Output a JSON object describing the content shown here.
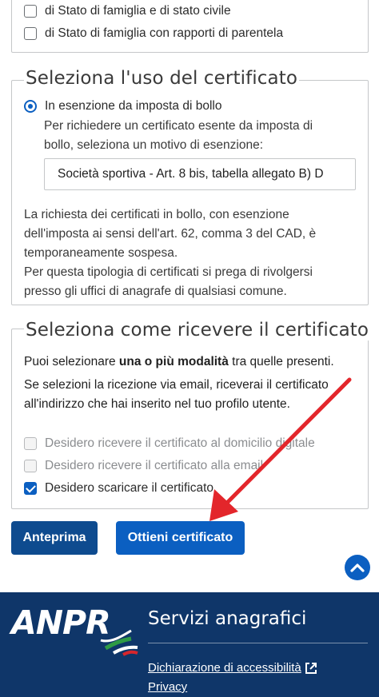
{
  "section_top": {
    "options": [
      {
        "label": "di Stato di famiglia e di stato civile",
        "checked": false
      },
      {
        "label": "di Stato di famiglia con rapporti di parentela",
        "checked": false
      }
    ]
  },
  "uso": {
    "legend": "Seleziona l'uso del certificato",
    "radio_label": "In esenzione da imposta di bollo",
    "hint_line1": "Per richiedere un certificato esente da imposta di",
    "hint_line2": "bollo, seleziona un motivo di esenzione:",
    "select_value": "Società sportiva - Art. 8 bis, tabella allegato B) D",
    "notice_line1": "La richiesta dei certificati in bollo, con esenzione",
    "notice_line2": "dell'imposta ai sensi dell'art. 62, comma 3 del CAD, è",
    "notice_line3": "temporaneamente sospesa.",
    "notice_line4": "Per questa tipologia di certificati si prega di rivolgersi",
    "notice_line5": "presso gli uffici di anagrafe di qualsiasi comune."
  },
  "ricezione": {
    "legend": "Seleziona come ricevere il certificato",
    "intro_before": "Puoi selezionare ",
    "intro_bold": "una o più modalità",
    "intro_after": " tra quelle presenti.",
    "email_line1": "Se selezioni la ricezione via email, riceverai il certificato",
    "email_line2": "all'indirizzo che hai inserito nel tuo profilo utente.",
    "options": [
      {
        "label": "Desidero ricevere il certificato al domicilio digitale",
        "checked": false,
        "disabled": true
      },
      {
        "label": "Desidero ricevere il certificato alla email",
        "checked": false,
        "disabled": true
      },
      {
        "label": "Desidero scaricare il certificato",
        "checked": true,
        "disabled": false
      }
    ]
  },
  "buttons": {
    "preview": "Anteprima",
    "get": "Ottieni certificato"
  },
  "footer": {
    "logo": "ANPR",
    "title": "Servizi anagrafici",
    "link_accessibility": "Dichiarazione di accessibilità",
    "link_privacy": "Privacy"
  },
  "colors": {
    "primary": "#0b5fc1",
    "primary_dark": "#0e4b8f",
    "footer_bg": "#0f3669",
    "annotation_arrow": "#e3262b"
  }
}
